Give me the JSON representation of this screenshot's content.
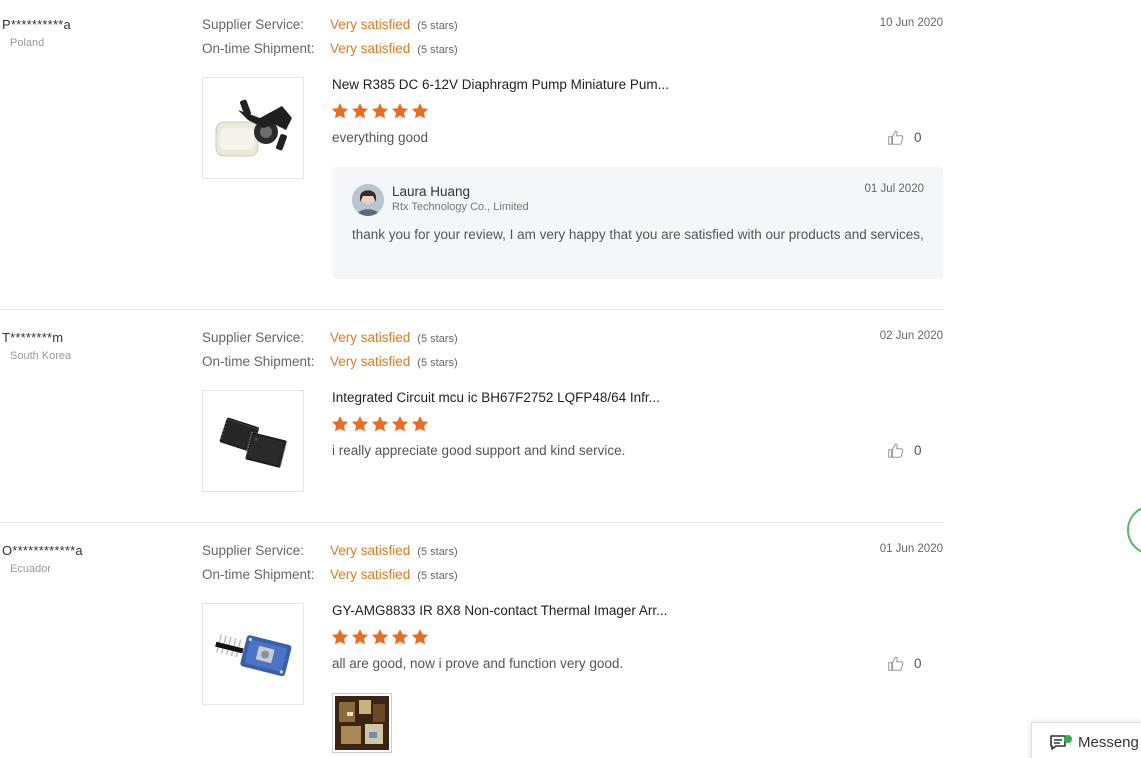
{
  "rating_labels": {
    "supplier_service": "Supplier Service:",
    "on_time_shipment": "On-time Shipment:"
  },
  "reviews": [
    {
      "buyer": "P**********a",
      "country": "Poland",
      "date": "10 Jun 2020",
      "supplier_service": {
        "value": "Very satisfied",
        "stars_note": "(5 stars)"
      },
      "on_time_shipment": {
        "value": "Very satisfied",
        "stars_note": "(5 stars)"
      },
      "product_title": "New R385 DC 6-12V Diaphragm Pump Miniature Pum...",
      "product_image": "diaphragm-pump",
      "rating": 5,
      "comment": "everything good",
      "likes": "0",
      "reply": {
        "seller_name": "Laura Huang",
        "company": "Rtx Technology Co., Limited",
        "date": "01 Jul 2020",
        "text": "thank you for your review, I am very happy that you are satisfied with our products and services,"
      }
    },
    {
      "buyer": "T********m",
      "country": "South Korea",
      "date": "02 Jun 2020",
      "supplier_service": {
        "value": "Very satisfied",
        "stars_note": "(5 stars)"
      },
      "on_time_shipment": {
        "value": "Very satisfied",
        "stars_note": "(5 stars)"
      },
      "product_title": "Integrated Circuit mcu ic BH67F2752 LQFP48/64 Infr...",
      "product_image": "ic-chips",
      "rating": 5,
      "comment": "i really appreciate good support and kind service.",
      "likes": "0"
    },
    {
      "buyer": "O************a",
      "country": "Ecuador",
      "date": "01 Jun 2020",
      "supplier_service": {
        "value": "Very satisfied",
        "stars_note": "(5 stars)"
      },
      "on_time_shipment": {
        "value": "Very satisfied",
        "stars_note": "(5 stars)"
      },
      "product_title": "GY-AMG8833 IR 8X8 Non-contact Thermal Imager Arr...",
      "product_image": "thermal-sensor-module",
      "rating": 5,
      "comment": "all are good, now i prove and function very good.",
      "likes": "0",
      "photo": "buyer-uploaded-photo"
    }
  ],
  "messenger": {
    "label": "Messeng",
    "status_color": "#28b446"
  },
  "colors": {
    "accent": "#e07a1f",
    "star": "#ee6a1c",
    "divider": "#e5e5e5",
    "reply_bg": "#f5f6f9"
  },
  "icons": {
    "like": "thumbs-up-icon",
    "star": "star-icon",
    "messenger": "chat-icon"
  }
}
